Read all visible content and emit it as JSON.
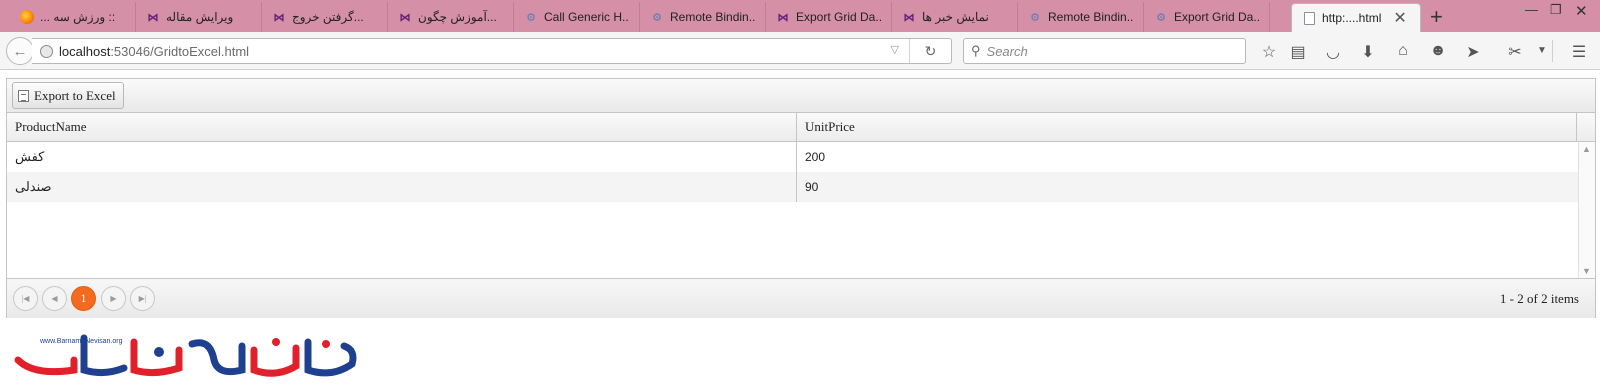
{
  "browser": {
    "tabs": [
      {
        "label": ":: ورزش سه ...",
        "icon": "firefox-icon",
        "rtl": true
      },
      {
        "label": "ویرایش مقاله",
        "icon": "visual-studio-icon",
        "rtl": true
      },
      {
        "label": "...گرفتن خروج",
        "icon": "visual-studio-icon",
        "rtl": true
      },
      {
        "label": "...آموزش چگون",
        "icon": "visual-studio-icon",
        "rtl": true
      },
      {
        "label": "Call Generic H...",
        "icon": "gear-page-icon",
        "rtl": false
      },
      {
        "label": "Remote Bindin...",
        "icon": "gear-page-icon",
        "rtl": false
      },
      {
        "label": "Export Grid Da...",
        "icon": "visual-studio-icon",
        "rtl": false
      },
      {
        "label": "نمایش خبر ها",
        "icon": "visual-studio-icon",
        "rtl": true
      },
      {
        "label": "Remote Bindin...",
        "icon": "gear-page-icon",
        "rtl": false
      },
      {
        "label": "Export Grid Da...",
        "icon": "gear-page-icon",
        "rtl": false
      },
      {
        "label": "http:....html",
        "icon": "page-icon",
        "rtl": false,
        "active": true
      }
    ],
    "url_host": "localhost",
    "url_path": ":53046/GridtoExcel.html",
    "search_placeholder": "Search"
  },
  "grid": {
    "toolbar": {
      "export_label": "Export to Excel"
    },
    "columns": [
      "ProductName",
      "UnitPrice"
    ],
    "rows": [
      {
        "product": "کفش",
        "price": "200"
      },
      {
        "product": "صندلی",
        "price": "90"
      }
    ],
    "pager": {
      "current_page": "1",
      "info": "1 - 2 of 2 items"
    }
  },
  "logo": {
    "url_text": "www.BarnameNevisan.org"
  },
  "colors": {
    "tabstrip": "#d58fa7",
    "pager_current": "#f36b21",
    "logo_red": "#e0202a",
    "logo_blue": "#1f3f8f"
  }
}
